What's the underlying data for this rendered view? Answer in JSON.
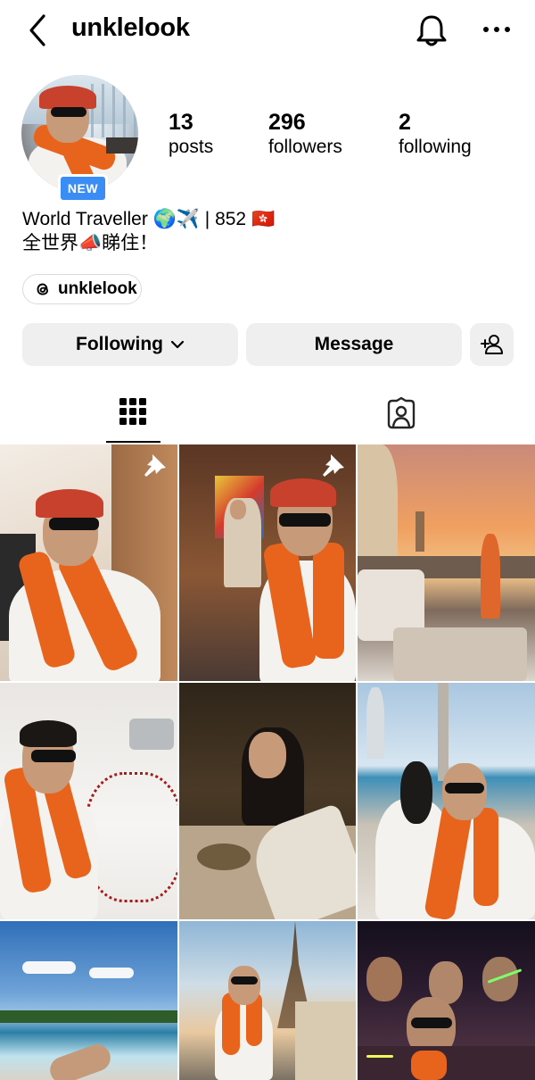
{
  "header": {
    "username": "unklelook",
    "back_icon": "chevron-left-icon",
    "bell_icon": "bell-icon",
    "more_icon": "more-horizontal-icon"
  },
  "profile": {
    "badge": "NEW",
    "stats": [
      {
        "value": "13",
        "label": "posts"
      },
      {
        "value": "296",
        "label": "followers"
      },
      {
        "value": "2",
        "label": "following"
      }
    ],
    "bio_line1": "World Traveller 🌍✈️ | 852 🇭🇰",
    "bio_line2": "全世界📣睇住！",
    "threads_handle": "unklelook"
  },
  "actions": {
    "following_label": "Following",
    "message_label": "Message",
    "add_user_icon": "add-person-icon"
  },
  "tabs": {
    "grid_icon": "grid-icon",
    "tagged_icon": "tagged-person-icon"
  },
  "colors": {
    "badge_blue": "#3a8df5",
    "button_gray": "#efefef",
    "chip_border": "#dbdbdb"
  }
}
